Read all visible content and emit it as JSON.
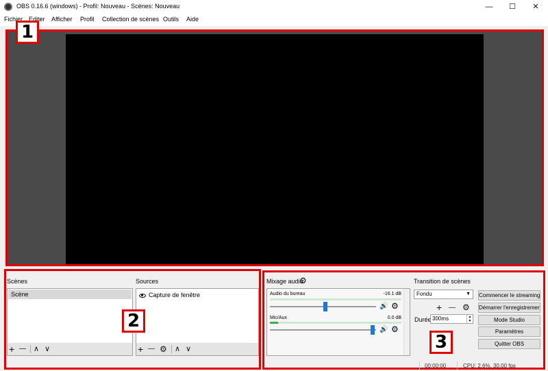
{
  "window": {
    "title": "OBS 0.16.6 (windows) - Profil: Nouveau - Scènes: Nouveau",
    "minimize": "—",
    "maximize": "☐",
    "close": "✕"
  },
  "menu": [
    "Fichier",
    "Editer",
    "Afficher",
    "Profil",
    "Collection de scènes",
    "Outils",
    "Aide"
  ],
  "badges": [
    "1",
    "2",
    "3"
  ],
  "scenes": {
    "title": "Scènes",
    "items": [
      "Scène"
    ]
  },
  "sources": {
    "title": "Sources",
    "items": [
      "Capture de fenêtre"
    ]
  },
  "mixer": {
    "title": "Mixage audio",
    "channels": [
      {
        "name": "Audio du bureau",
        "db": "-16.1 dB"
      },
      {
        "name": "Mic/Aux",
        "db": "0.0 dB"
      }
    ]
  },
  "transitions": {
    "title": "Transition de scènes",
    "selected": "Fondu",
    "duration_label": "Durée",
    "duration_value": "300ms"
  },
  "controls": {
    "start_streaming": "Commencer le streaming",
    "start_recording": "Démarrer l'enregistrement",
    "studio_mode": "Mode Studio",
    "settings": "Paramètres",
    "quit": "Quitter OBS"
  },
  "status": {
    "time": "00:00:00",
    "cpu": "CPU: 2.6%, 30.00 fps"
  },
  "icons": {
    "add": "+",
    "remove": "—",
    "up": "∧",
    "down": "∨",
    "gear": "⚙",
    "speaker": "🔊"
  },
  "colors": {
    "highlight_red": "#e00000",
    "canvas_bg": "#000000",
    "preview_bg": "#4a4a4a",
    "slider": "#1e78d6",
    "meter_green": "#3cb043"
  }
}
